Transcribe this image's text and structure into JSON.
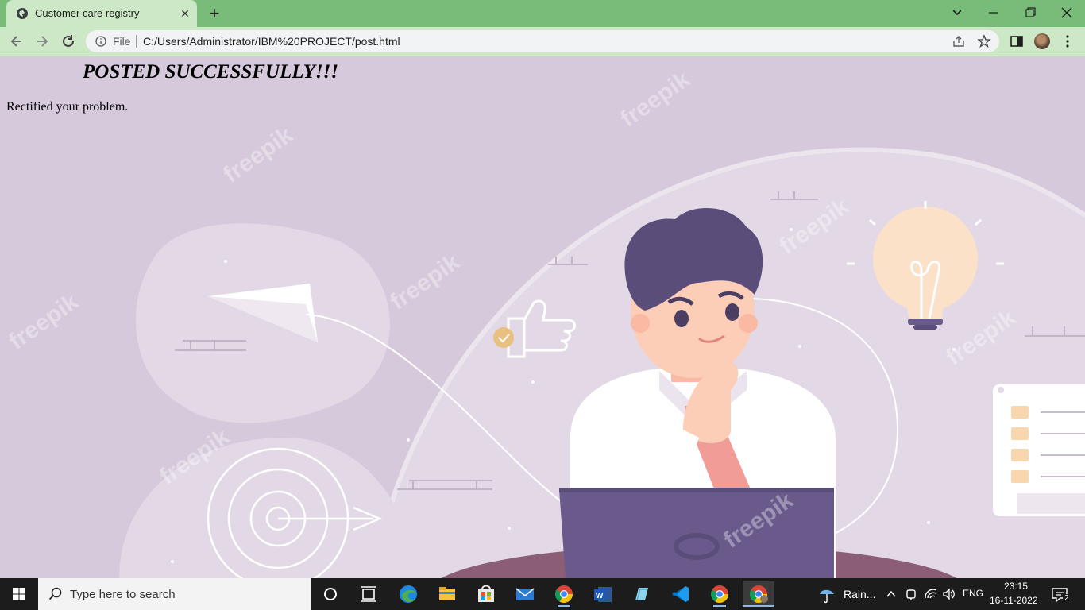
{
  "browser": {
    "tab_title": "Customer care registry",
    "address_scheme": "File",
    "address_url": "C:/Users/Administrator/IBM%20PROJECT/post.html"
  },
  "page": {
    "heading": "POSTED SUCCESSFULLY!!!",
    "message": "Rectified your problem.",
    "watermark": "freepik"
  },
  "taskbar": {
    "search_placeholder": "Type here to search",
    "weather": "Rain...",
    "language": "ENG",
    "time": "23:15",
    "date": "16-11-2022",
    "notification_count": "2",
    "apps": [
      "task-view",
      "microsoft-edge",
      "file-explorer",
      "microsoft-store",
      "mail",
      "google-chrome",
      "microsoft-word",
      "notepad",
      "visual-studio-code",
      "google-chrome",
      "google-chrome-profile"
    ]
  },
  "colors": {
    "tabbar": "#79bb78",
    "toolbar": "#cde8c6",
    "page_background": "#d6c9db",
    "taskbar": "#1c1c1c"
  }
}
